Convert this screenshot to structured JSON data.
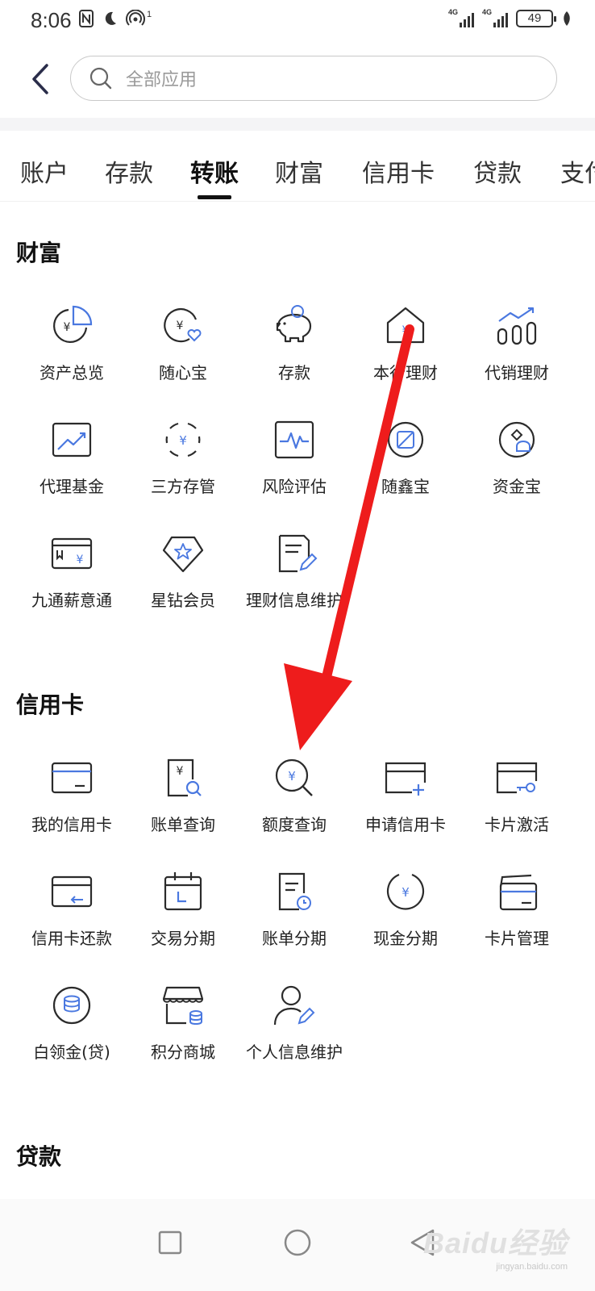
{
  "status_bar": {
    "time": "8:06",
    "nfc_superscript": "1",
    "signal_1_label": "4G",
    "signal_2_label": "4G",
    "battery": "49"
  },
  "search": {
    "placeholder": "全部应用"
  },
  "tabs": [
    {
      "label": "账户"
    },
    {
      "label": "存款"
    },
    {
      "label": "转账",
      "active": true
    },
    {
      "label": "财富"
    },
    {
      "label": "信用卡"
    },
    {
      "label": "贷款"
    },
    {
      "label": "支付"
    }
  ],
  "sections": {
    "wealth": {
      "title": "财富",
      "items": [
        {
          "label": "资产总览",
          "icon": "asset-overview-icon"
        },
        {
          "label": "随心宝",
          "icon": "yuan-heart-icon"
        },
        {
          "label": "存款",
          "icon": "piggy-bank-icon"
        },
        {
          "label": "本行理财",
          "icon": "house-yuan-icon"
        },
        {
          "label": "代销理财",
          "icon": "bar-chart-trend-icon"
        },
        {
          "label": "代理基金",
          "icon": "trend-chart-icon"
        },
        {
          "label": "三方存管",
          "icon": "yuan-cycle-icon"
        },
        {
          "label": "风险评估",
          "icon": "pulse-monitor-icon"
        },
        {
          "label": "随鑫宝",
          "icon": "coin-square-icon"
        },
        {
          "label": "资金宝",
          "icon": "money-bag-icon"
        },
        {
          "label": "九通薪意通",
          "icon": "salary-card-icon"
        },
        {
          "label": "星钻会员",
          "icon": "star-diamond-icon"
        },
        {
          "label": "理财信息维护",
          "icon": "document-edit-icon"
        }
      ]
    },
    "credit_card": {
      "title": "信用卡",
      "items": [
        {
          "label": "我的信用卡",
          "icon": "credit-card-icon"
        },
        {
          "label": "账单查询",
          "icon": "bill-search-icon"
        },
        {
          "label": "额度查询",
          "icon": "yuan-magnifier-icon"
        },
        {
          "label": "申请信用卡",
          "icon": "card-add-icon"
        },
        {
          "label": "卡片激活",
          "icon": "card-key-icon"
        },
        {
          "label": "信用卡还款",
          "icon": "card-repay-icon"
        },
        {
          "label": "交易分期",
          "icon": "calendar-icon"
        },
        {
          "label": "账单分期",
          "icon": "bill-clock-icon"
        },
        {
          "label": "现金分期",
          "icon": "yuan-circle-icon"
        },
        {
          "label": "卡片管理",
          "icon": "cards-stack-icon"
        },
        {
          "label": "白领金(贷)",
          "icon": "coin-stack-icon"
        },
        {
          "label": "积分商城",
          "icon": "store-icon"
        },
        {
          "label": "个人信息维护",
          "icon": "user-edit-icon"
        }
      ]
    },
    "loan": {
      "title": "贷款"
    }
  },
  "watermark": {
    "brand": "Baidu经验",
    "url": "jingyan.baidu.com"
  },
  "colors": {
    "icon_stroke": "#2b2b2b",
    "icon_accent": "#4a78e0",
    "arrow": "#ee1c1c"
  }
}
